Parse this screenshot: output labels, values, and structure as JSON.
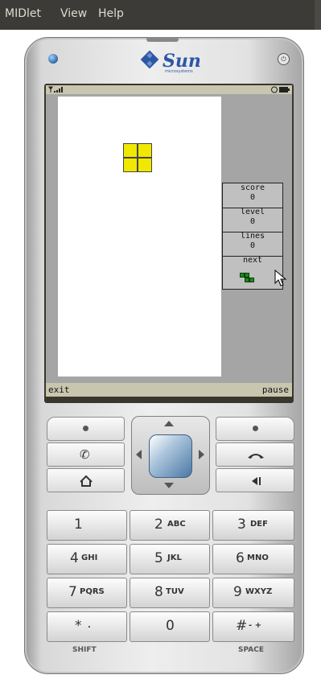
{
  "menubar": {
    "midlet": "MIDlet",
    "view": "View",
    "help": "Help"
  },
  "brand": {
    "name": "Sun",
    "tagline": "microsystems"
  },
  "game": {
    "labels": {
      "score": "score",
      "level": "level",
      "lines": "lines",
      "next": "next"
    },
    "score": "0",
    "level": "0",
    "lines": "0"
  },
  "softkeys": {
    "left": "exit",
    "right": "pause"
  },
  "keypad": {
    "k1": {
      "num": "1",
      "sub": ""
    },
    "k2": {
      "num": "2",
      "sub": "ABC"
    },
    "k3": {
      "num": "3",
      "sub": "DEF"
    },
    "k4": {
      "num": "4",
      "sub": "GHI"
    },
    "k5": {
      "num": "5",
      "sub": "JKL"
    },
    "k6": {
      "num": "6",
      "sub": "MNO"
    },
    "k7": {
      "num": "7",
      "sub": "PQRS"
    },
    "k8": {
      "num": "8",
      "sub": "TUV"
    },
    "k9": {
      "num": "9",
      "sub": "WXYZ"
    },
    "kstar": {
      "num": "*",
      "sub": "."
    },
    "k0": {
      "num": "0",
      "sub": ""
    },
    "khash": {
      "num": "#",
      "sub": "- +"
    }
  },
  "keylabels": {
    "shift": "SHIFT",
    "space": "SPACE"
  },
  "colors": {
    "menubar_bg": "#3c3b37",
    "block": "#f0e800",
    "next_piece": "#1a8a1a",
    "lcd_bar": "#c8c6ae"
  }
}
